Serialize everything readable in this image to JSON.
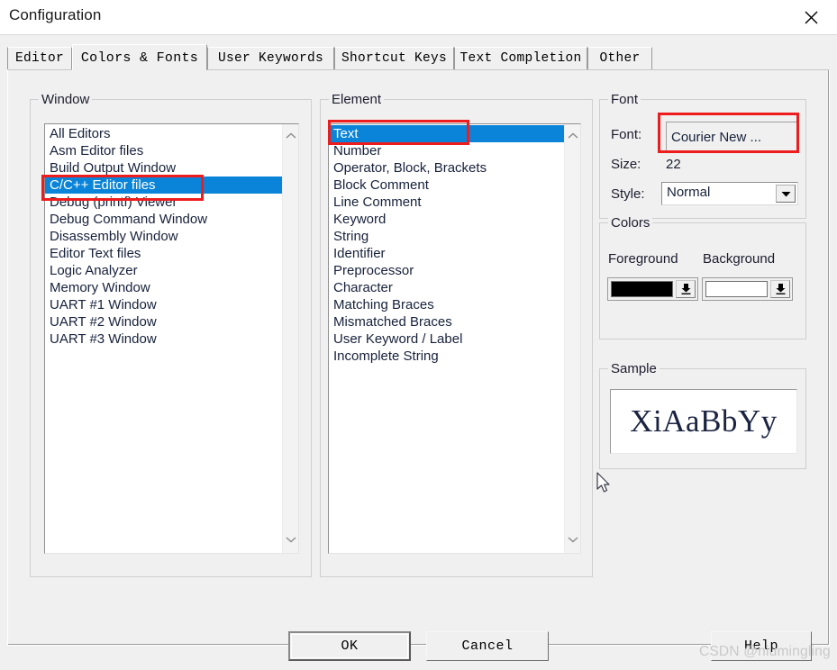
{
  "window": {
    "title": "Configuration",
    "close_icon": "close-x-icon"
  },
  "tabs": [
    {
      "label": "Editor",
      "active": false
    },
    {
      "label": "Colors & Fonts",
      "active": true
    },
    {
      "label": "User Keywords",
      "active": false
    },
    {
      "label": "Shortcut Keys",
      "active": false
    },
    {
      "label": "Text Completion",
      "active": false
    },
    {
      "label": "Other",
      "active": false
    }
  ],
  "window_group": {
    "label": "Window",
    "items": [
      {
        "label": "All Editors",
        "selected": false
      },
      {
        "label": "Asm Editor files",
        "selected": false
      },
      {
        "label": "Build Output Window",
        "selected": false
      },
      {
        "label": "C/C++ Editor files",
        "selected": true
      },
      {
        "label": "Debug (printf) Viewer",
        "selected": false
      },
      {
        "label": "Debug Command Window",
        "selected": false
      },
      {
        "label": "Disassembly Window",
        "selected": false
      },
      {
        "label": "Editor Text files",
        "selected": false
      },
      {
        "label": "Logic Analyzer",
        "selected": false
      },
      {
        "label": "Memory Window",
        "selected": false
      },
      {
        "label": "UART #1 Window",
        "selected": false
      },
      {
        "label": "UART #2 Window",
        "selected": false
      },
      {
        "label": "UART #3 Window",
        "selected": false
      }
    ]
  },
  "element_group": {
    "label": "Element",
    "items": [
      {
        "label": "Text",
        "selected": true
      },
      {
        "label": "Number",
        "selected": false
      },
      {
        "label": "Operator, Block, Brackets",
        "selected": false
      },
      {
        "label": "Block Comment",
        "selected": false
      },
      {
        "label": "Line Comment",
        "selected": false
      },
      {
        "label": "Keyword",
        "selected": false
      },
      {
        "label": "String",
        "selected": false
      },
      {
        "label": "Identifier",
        "selected": false
      },
      {
        "label": "Preprocessor",
        "selected": false
      },
      {
        "label": "Character",
        "selected": false
      },
      {
        "label": "Matching Braces",
        "selected": false
      },
      {
        "label": "Mismatched Braces",
        "selected": false
      },
      {
        "label": "User Keyword / Label",
        "selected": false
      },
      {
        "label": "Incomplete String",
        "selected": false
      }
    ]
  },
  "font_group": {
    "label": "Font",
    "font_label": "Font:",
    "font_value": "Courier New ...",
    "size_label": "Size:",
    "size_value": "22",
    "style_label": "Style:",
    "style_value": "Normal"
  },
  "colors_group": {
    "label": "Colors",
    "foreground_label": "Foreground",
    "background_label": "Background",
    "foreground_color": "#000000",
    "background_color": "#ffffff"
  },
  "sample_group": {
    "label": "Sample",
    "text": "XiAaBbYy"
  },
  "buttons": {
    "ok": "OK",
    "cancel": "Cancel",
    "help": "Help"
  },
  "watermark": "CSDN @niumingling",
  "theme": {
    "selection_blue": "#0a84d8",
    "dialog_bg": "#f0f0f0",
    "annotation_red": "#ee1c1c"
  }
}
